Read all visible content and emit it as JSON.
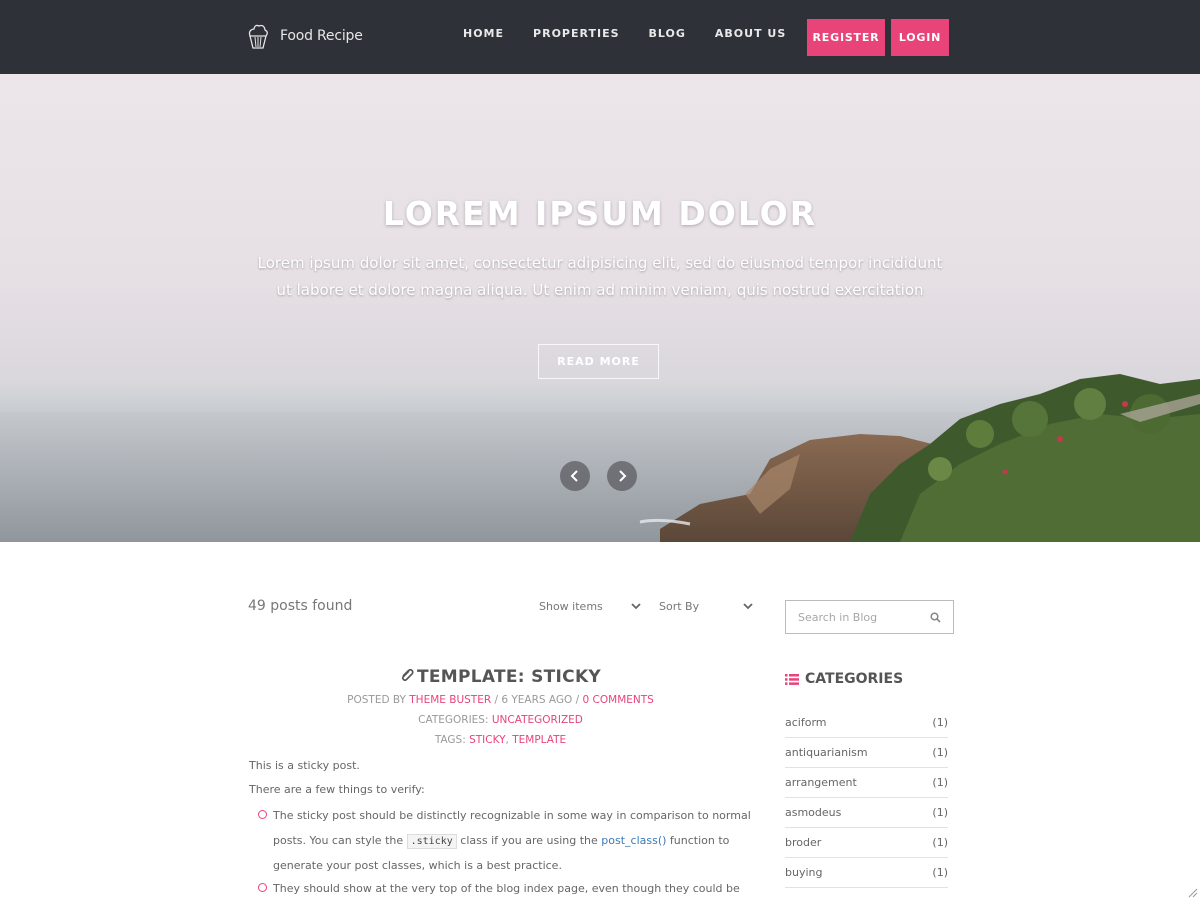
{
  "header": {
    "logo_text": "Food Recipe",
    "nav": [
      "HOME",
      "PROPERTIES",
      "BLOG",
      "ABOUT US"
    ],
    "register_label": "REGISTER",
    "login_label": "LOGIN"
  },
  "hero": {
    "title": "LOREM IPSUM DOLOR",
    "subtitle": "Lorem ipsum dolor sit amet, consectetur adipisicing elit, sed do eiusmod tempor incididunt ut labore et dolore magna aliqua. Ut enim ad minim veniam, quis nostrud exercitation",
    "button_label": "READ MORE"
  },
  "toolbar": {
    "posts_found": "49 posts found",
    "show_items": "Show items",
    "sort_by": "Sort By"
  },
  "search": {
    "placeholder": "Search in Blog"
  },
  "post": {
    "title": "TEMPLATE: STICKY",
    "posted_by_label": "POSTED BY",
    "author": "THEME BUSTER",
    "age": "6 YEARS AGO",
    "comments": "0 COMMENTS",
    "categories_label": "CATEGORIES:",
    "category": "UNCATEGORIZED",
    "tags_label": "TAGS:",
    "tags": [
      "STICKY",
      "TEMPLATE"
    ],
    "p1": "This is a sticky post.",
    "p2": "There are a few things to verify:",
    "li1_a": "The sticky post should be distinctly recognizable in some way in comparison to normal posts. You can style the",
    "li1_code": ".sticky",
    "li1_b": "class if you are using the",
    "li1_link": "post_class()",
    "li1_c": "function to generate your post classes, which is a best practice.",
    "li2": "They should show at the very top of the blog index page, even though they could be several"
  },
  "sidebar": {
    "categories_title": "CATEGORIES",
    "categories": [
      {
        "name": "aciform",
        "count": "(1)"
      },
      {
        "name": "antiquarianism",
        "count": "(1)"
      },
      {
        "name": "arrangement",
        "count": "(1)"
      },
      {
        "name": "asmodeus",
        "count": "(1)"
      },
      {
        "name": "broder",
        "count": "(1)"
      },
      {
        "name": "buying",
        "count": "(1)"
      }
    ]
  },
  "colors": {
    "header_bg": "#2f3139",
    "accent": "#e8447a"
  },
  "icons": [
    "cupcake-logo-icon",
    "search-icon",
    "paperclip-icon",
    "list-icon",
    "chevron-down-icon",
    "chevron-left-icon",
    "chevron-right-icon"
  ]
}
